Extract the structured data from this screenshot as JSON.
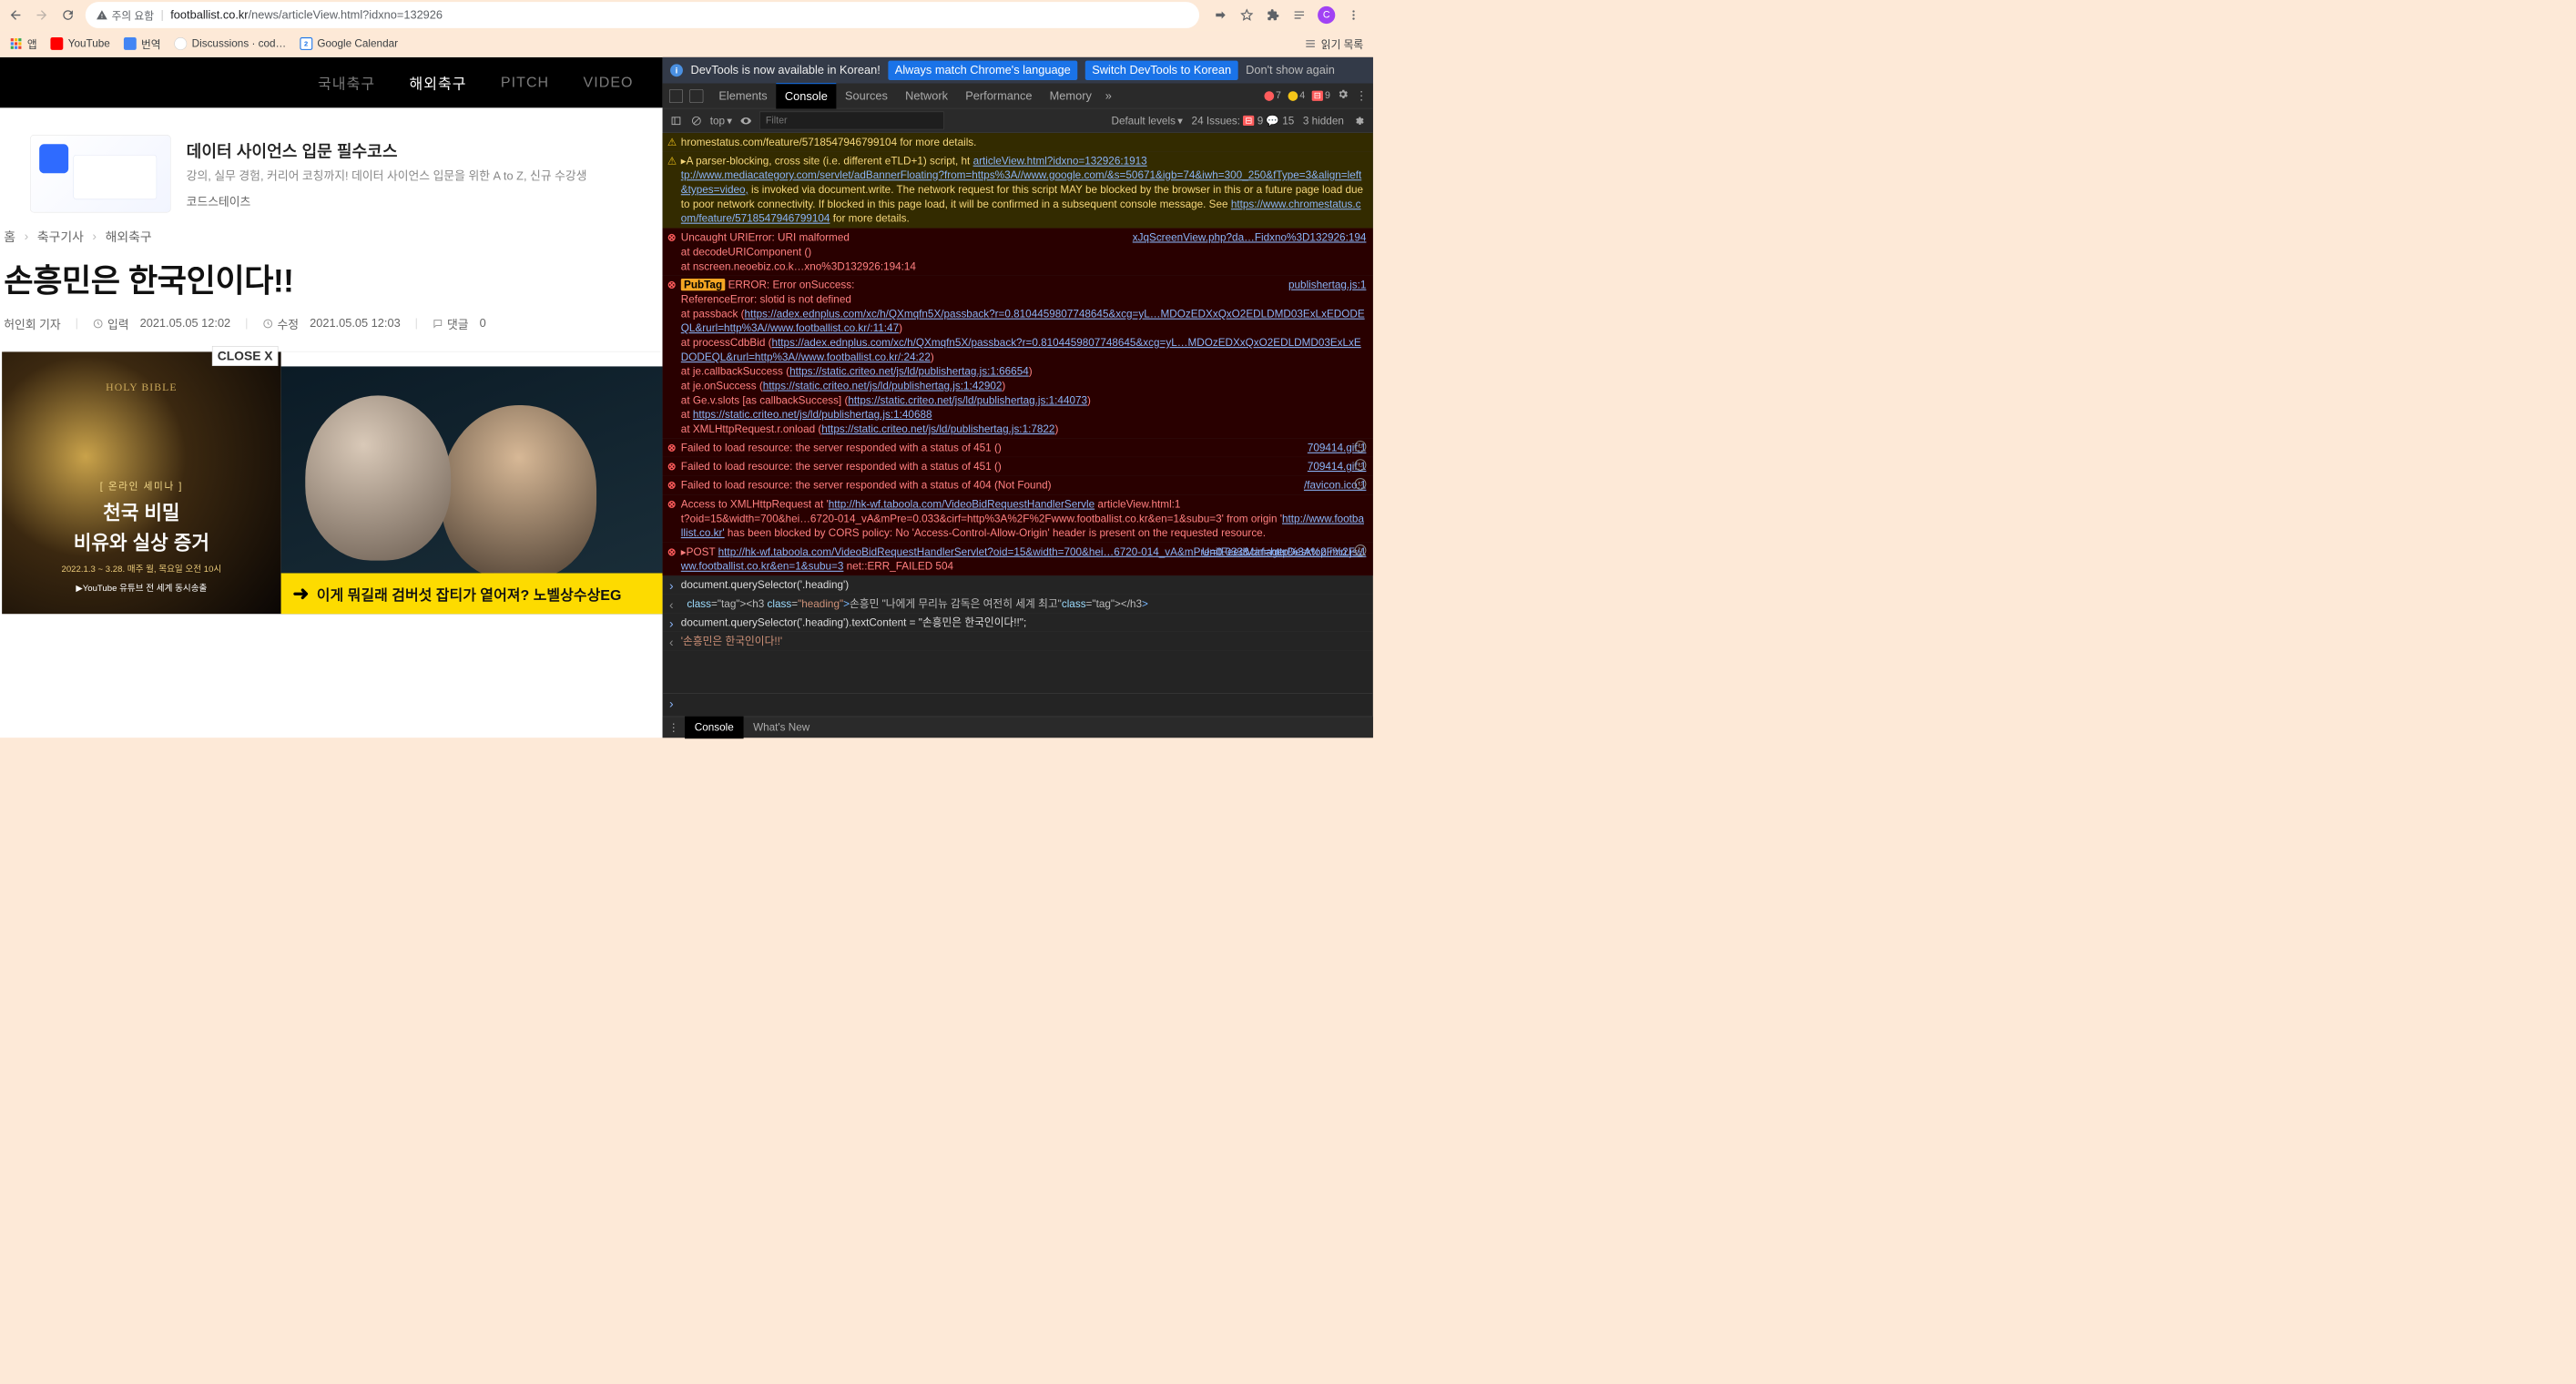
{
  "browser": {
    "url_host": "footballist.co.kr",
    "url_path": "/news/articleView.html?idxno=132926",
    "security_label": "주의 요함",
    "avatar_letter": "C",
    "reading_list": "읽기 목록"
  },
  "bookmarks": {
    "items": [
      {
        "label": "앱",
        "icon_bg": "#ea4335"
      },
      {
        "label": "YouTube",
        "icon_bg": "#ff0000"
      },
      {
        "label": "번역",
        "icon_bg": "#4285f4"
      },
      {
        "label": "Discussions · cod…",
        "icon_bg": "#333"
      },
      {
        "label": "Google Calendar",
        "icon_bg": "#1a73e8"
      }
    ]
  },
  "site_nav": {
    "items": [
      "국내축구",
      "해외축구",
      "PITCH",
      "VIDEO"
    ],
    "active_index": 1
  },
  "ad": {
    "title": "데이터 사이언스 입문 필수코스",
    "sub": "강의, 실무 경험, 커리어 코칭까지! 데이터 사이언스 입문을 위한 A to Z, 신규 수강생",
    "brand": "코드스테이츠"
  },
  "breadcrumb": [
    "홈",
    "축구기사",
    "해외축구"
  ],
  "article": {
    "headline": "손흥민은 한국인이다!!",
    "author": "허인회 기자",
    "input_time_label": "입력",
    "input_time": "2021.05.05 12:02",
    "edit_time_label": "수정",
    "edit_time": "2021.05.05 12:03",
    "comments_label": "댓글",
    "comments": "0",
    "close_label": "CLOSE X",
    "overlay": {
      "line1": "[ 온라인 세미나 ]",
      "line2": "천국 비밀",
      "line3": "비유와 실상 증거",
      "line4": "2022.1.3 ~ 3.28. 매주 월, 목요일 오전 10시",
      "line5": "▶YouTube 유튜브 전 세계 동시송출"
    },
    "yellow_strip": "이게 뭐길래 검버섯 잡티가 옅어져? 노벨상수상EG"
  },
  "devtools": {
    "banner": {
      "msg": "DevTools is now available in Korean!",
      "btn1": "Always match Chrome's language",
      "btn2": "Switch DevTools to Korean",
      "link": "Don't show again"
    },
    "tabs": [
      "Elements",
      "Console",
      "Sources",
      "Network",
      "Performance",
      "Memory"
    ],
    "active_tab": 1,
    "tab_badges": {
      "errors": "7",
      "warnings": "4",
      "blocked": "9"
    },
    "toolbar": {
      "context": "top",
      "filter_placeholder": "Filter",
      "levels": "Default levels",
      "issues_label": "24 Issues:",
      "issues_err": "9",
      "issues_info": "15",
      "hidden": "3 hidden"
    },
    "logs": [
      {
        "type": "warn",
        "text": "hromestatus.com/feature/5718547946799104 for more details.",
        "src": ""
      },
      {
        "type": "warn",
        "text": "▸A parser-blocking, cross site (i.e. different eTLD+1) script, ht articleView.html?idxno=132926:1913\ntp://www.mediacategory.com/servlet/adBannerFloating?from=https%3A//www.google.com/&s=50671&igb=74&iwh=300_250&fType=3&align=left&types=video, is invoked via document.write. The network request for this script MAY be blocked by the browser in this or a future page load due to poor network connectivity. If blocked in this page load, it will be confirmed in a subsequent console message. See https://www.chromestatus.com/feature/5718547946799104 for more details.",
        "src": ""
      },
      {
        "type": "err",
        "text": "Uncaught URIError: URI malformed\n    at decodeURIComponent (<anonymous>)\n    at nscreen.neoebiz.co.k…xno%3D132926:194:14",
        "src": "xJqScreenView.php?da…Fidxno%3D132926:194"
      },
      {
        "type": "err",
        "pubtag": true,
        "text": "ERROR: Error onSuccess:\nReferenceError: slotid is not defined\n    at passback (https://adex.ednplus.com/xc/h/QXmqfn5X/passback?r=0.8104459807748645&xcg=yL…MDOzEDXxQxO2EDLDMD03ExLxEDODEQL&rurl=http%3A//www.footballist.co.kr/:11:47)\n    at processCdbBid (https://adex.ednplus.com/xc/h/QXmqfn5X/passback?r=0.8104459807748645&xcg=yL…MDOzEDXxQxO2EDLDMD03ExLxEDODEQL&rurl=http%3A//www.footballist.co.kr/:24:22)\n    at je.callbackSuccess (https://static.criteo.net/js/ld/publishertag.js:1:66654)\n    at je.onSuccess (https://static.criteo.net/js/ld/publishertag.js:1:42902)\n    at Ge.v.slots [as callbackSuccess] (https://static.criteo.net/js/ld/publishertag.js:1:44073)\n    at https://static.criteo.net/js/ld/publishertag.js:1:40688\n    at XMLHttpRequest.r.onload (https://static.criteo.net/js/ld/publishertag.js:1:7822)",
        "src": "publishertag.js:1"
      },
      {
        "type": "err",
        "text": "Failed to load resource: the server responded with a status of 451 ()",
        "src": "709414.gif:1",
        "repeat": true
      },
      {
        "type": "err",
        "text": "Failed to load resource: the server responded with a status of 451 ()",
        "src": "709414.gif:1",
        "repeat": true
      },
      {
        "type": "err",
        "text": "Failed to load resource: the server responded with a status of 404 (Not Found)",
        "src": "/favicon.ico:1",
        "repeat": true
      },
      {
        "type": "err",
        "text": "Access to XMLHttpRequest at 'http://hk-wf.taboola.com/VideoBidRequestHandlerServle articleView.html:1\nt?oid=15&width=700&hei…6720-014_vA&mPre=0.033&cirf=http%3A%2F%2Fwww.footballist.co.kr&en=1&subu=3' from origin 'http://www.footballist.co.kr' has been blocked by CORS policy: No 'Access-Control-Allow-Origin' header is present on the requested resource.",
        "src": ""
      },
      {
        "type": "err",
        "text": "▸POST http://hk-wf.taboola.com/VideoBidRequestHandlerServlet?oid=15&width=700&hei…6720-014_vA&mPre=0.033&cirf=http%3A%2F%2Fwww.footballist.co.kr&en=1&subu=3 net::ERR_FAILED 504",
        "src": "UnitFeedManagerDesktop.min.js:1",
        "repeat": true
      },
      {
        "type": "cmd",
        "text": "document.querySelector('.heading')"
      },
      {
        "type": "ret-html",
        "text": "<h3 class=\"heading\">손흥민 \"나에게 무리뉴 감독은 여전히 세계 최고\"</h3>"
      },
      {
        "type": "cmd",
        "text": "document.querySelector('.heading').textContent = \"손흥민은 한국인이다!!\";"
      },
      {
        "type": "ret",
        "text": "'손흥민은 한국인이다!!'"
      }
    ],
    "drawer": {
      "tabs": [
        "Console",
        "What's New"
      ],
      "active": 0
    }
  }
}
